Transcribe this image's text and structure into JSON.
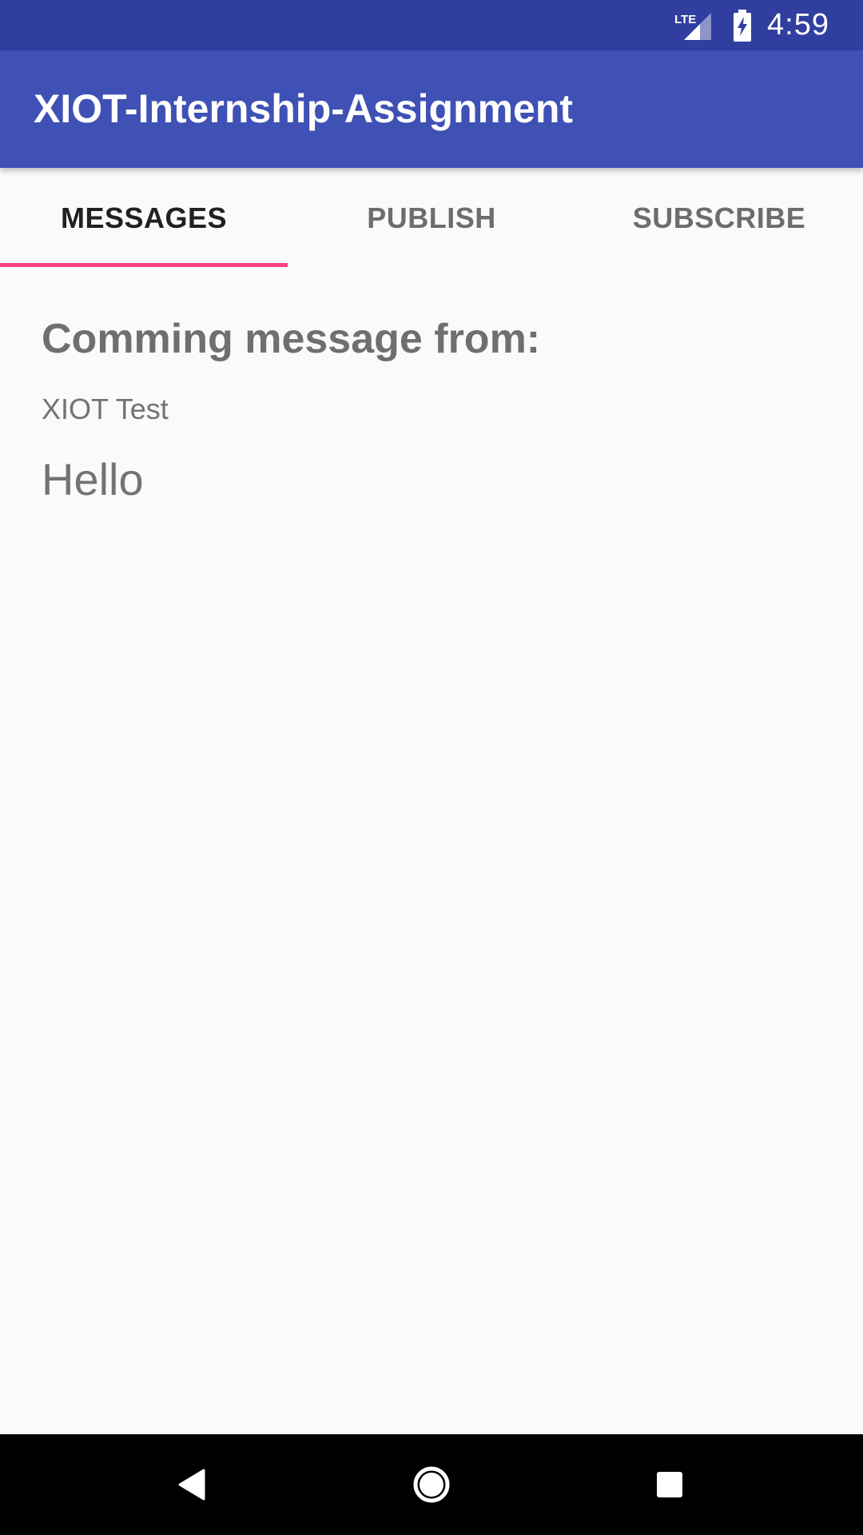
{
  "status_bar": {
    "time": "4:59",
    "network_label": "LTE",
    "icons": [
      "lte-signal-icon",
      "battery-charging-icon"
    ]
  },
  "app_bar": {
    "title": "XIOT-Internship-Assignment"
  },
  "tabs": [
    {
      "label": "MESSAGES",
      "active": true
    },
    {
      "label": "PUBLISH",
      "active": false
    },
    {
      "label": "SUBSCRIBE",
      "active": false
    }
  ],
  "content": {
    "heading": "Comming message from:",
    "topic": "XIOT Test",
    "message": "Hello"
  },
  "nav_bar": {
    "icons": [
      "back-icon",
      "home-icon",
      "recents-icon"
    ]
  },
  "colors": {
    "status_bar": "#303f9f",
    "primary": "#3f51b5",
    "accent": "#ff4081",
    "background": "#fafafa"
  }
}
